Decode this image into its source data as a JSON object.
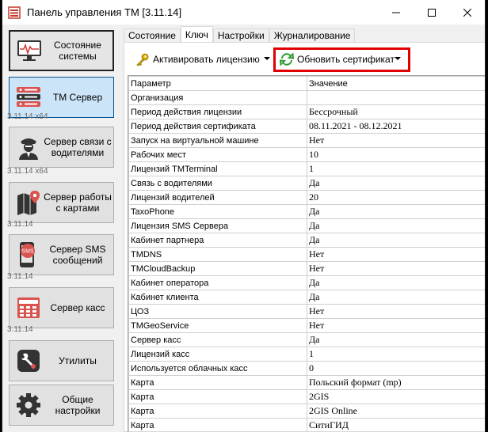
{
  "window": {
    "title": "Панель управления ТМ [3.11.14]"
  },
  "sidebar": {
    "items": [
      {
        "label": "Состояние системы",
        "version": ""
      },
      {
        "label": "ТМ Сервер",
        "version": "3.11.14 x64"
      },
      {
        "label": "Сервер связи с водителями",
        "version": "3.11.14 x64"
      },
      {
        "label": "Сервер работы с картами",
        "version": "3.11.14"
      },
      {
        "label": "Сервер SMS сообщений",
        "version": "3.11.14"
      },
      {
        "label": "Сервер касс",
        "version": "3.11.14"
      },
      {
        "label": "Утилиты",
        "version": ""
      },
      {
        "label": "Общие настройки",
        "version": ""
      }
    ],
    "sms_badge": "SMS"
  },
  "tabs": [
    "Состояние",
    "Ключ",
    "Настройки",
    "Журналирование"
  ],
  "toolbar": {
    "activate_label": "Активировать лицензию",
    "update_label": "Обновить сертификат"
  },
  "table": {
    "headers": [
      "Параметр",
      "Значение"
    ],
    "rows": [
      [
        "Организация",
        ""
      ],
      [
        "Период действия лицензии",
        "Бессрочный"
      ],
      [
        "Период действия сертификата",
        "08.11.2021 - 08.12.2021"
      ],
      [
        "Запуск на виртуальной машине",
        "Нет"
      ],
      [
        "Рабочих мест",
        "10"
      ],
      [
        "Лицензий TMTerminal",
        "1"
      ],
      [
        "Связь с водителями",
        "Да"
      ],
      [
        "Лицензий водителей",
        "20"
      ],
      [
        "TaxoPhone",
        "Да"
      ],
      [
        "Лицензия SMS Сервера",
        "Да"
      ],
      [
        "Кабинет партнера",
        "Да"
      ],
      [
        "TMDNS",
        "Нет"
      ],
      [
        "TMCloudBackup",
        "Нет"
      ],
      [
        "Кабинет оператора",
        "Да"
      ],
      [
        "Кабинет клиента",
        "Да"
      ],
      [
        "ЦОЗ",
        "Нет"
      ],
      [
        "TMGeoService",
        "Нет"
      ],
      [
        "Сервер касс",
        "Да"
      ],
      [
        "Лицензий касс",
        "1"
      ],
      [
        "Используется облачных касс",
        "0"
      ],
      [
        "Карта",
        "Польский формат (mp)"
      ],
      [
        "Карта",
        "2GIS"
      ],
      [
        "Карта",
        "2GIS Online"
      ],
      [
        "Карта",
        "СитиГИД"
      ]
    ]
  },
  "colors": {
    "highlight": "#e00000",
    "active_nav": "#cce4f7",
    "accent": "#005499"
  }
}
